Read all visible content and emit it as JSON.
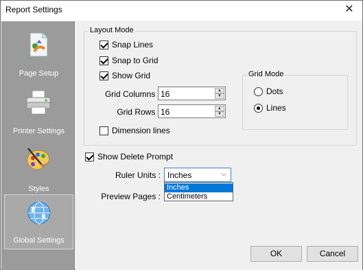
{
  "window": {
    "title": "Report Settings",
    "close_glyph": "✕"
  },
  "sidebar": {
    "items": [
      {
        "label": "Page Setup",
        "icon": "page-setup-icon"
      },
      {
        "label": "Printer Settings",
        "icon": "printer-icon"
      },
      {
        "label": "Styles",
        "icon": "palette-icon"
      },
      {
        "label": "Global Settings",
        "icon": "globe-icon",
        "active": true
      }
    ]
  },
  "layout_mode": {
    "label": "Layout Mode",
    "snap_lines": {
      "label": "Snap Lines",
      "checked": true
    },
    "snap_to_grid": {
      "label": "Snap to Grid",
      "checked": true
    },
    "show_grid": {
      "label": "Show Grid",
      "checked": true
    },
    "grid_columns": {
      "label": "Grid Columns :",
      "value": "16"
    },
    "grid_rows": {
      "label": "Grid Rows :",
      "value": "16"
    },
    "dimension_lines": {
      "label": "Dimension lines",
      "checked": false
    }
  },
  "grid_mode": {
    "label": "Grid Mode",
    "dots": {
      "label": "Dots",
      "selected": false
    },
    "lines": {
      "label": "Lines",
      "selected": true
    }
  },
  "show_delete_prompt": {
    "label": "Show Delete Prompt",
    "checked": true
  },
  "ruler_units": {
    "label": "Ruler Units :",
    "value": "Inches",
    "options": [
      "Inches",
      "Centimeters"
    ],
    "highlighted": "Inches"
  },
  "preview_pages": {
    "label": "Preview Pages :"
  },
  "buttons": {
    "ok": "OK",
    "cancel": "Cancel"
  },
  "colors": {
    "sidebar_bg": "#9b9b9b",
    "selection_blue": "#0078d7"
  }
}
